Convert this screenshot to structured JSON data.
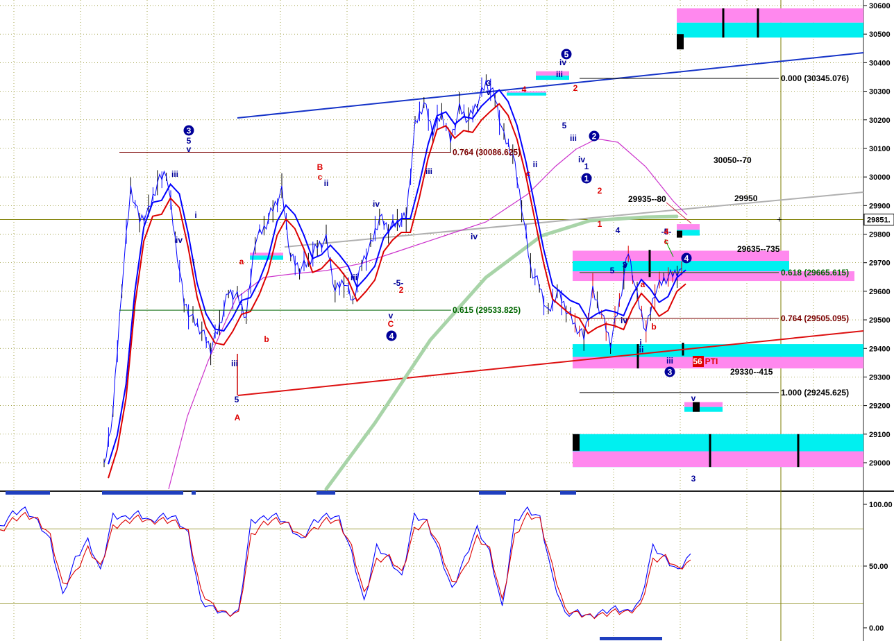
{
  "chart_data": [
    {
      "type": "line",
      "panel": "price",
      "y_axis": {
        "ticks": [
          "30600",
          "30500",
          "30400",
          "30300",
          "30200",
          "30100",
          "30000",
          "29900",
          "29800",
          "29700",
          "29600",
          "29500",
          "29400",
          "29300",
          "29200",
          "29100",
          "29000"
        ],
        "ylim": [
          28920,
          30640
        ],
        "current_price_label": "29851.",
        "grid": true
      },
      "fib_levels": [
        {
          "label": "0.000 (30345.076)",
          "value": 30345.076
        },
        {
          "label": "0.764 (30086.625)",
          "value": 30086.625
        },
        {
          "label": "0.618 (29665.615)",
          "value": 29665.615
        },
        {
          "label": "0.615 (29533.825)",
          "value": 29533.825
        },
        {
          "label": "0.764 (29505.095)",
          "value": 29505.095
        },
        {
          "label": "1.000 (29245.625)",
          "value": 29245.625
        }
      ],
      "zone_labels": [
        "30050--70",
        "29935--80",
        "29950",
        "29635--735",
        "29330--415"
      ],
      "wave_labels": {
        "circled": [
          "3",
          "5",
          "2",
          "1",
          "4",
          "4",
          "3"
        ],
        "blue": [
          "5",
          "v",
          "iii",
          "iv",
          "i",
          "iii",
          "i",
          "ii",
          "iii",
          "iv",
          "iii",
          "v",
          "iv",
          "3",
          "v",
          "ii",
          "iii",
          "iv",
          "5",
          "iii",
          "iv",
          "1",
          "3",
          "5",
          "4",
          "iv",
          "i",
          "ii",
          "iii",
          "v",
          "3",
          "5",
          "-5-",
          "-5-",
          "v"
        ],
        "red": [
          "A",
          "a",
          "b",
          "B",
          "c",
          "C",
          "2",
          "c",
          "a",
          "b",
          "c",
          "1",
          "2",
          "4",
          "2",
          "4",
          "56",
          "PTI"
        ]
      },
      "price_series": {
        "name": "",
        "x": [
          0,
          4,
          8,
          12,
          16,
          20,
          24,
          28,
          32,
          36,
          40,
          44,
          48,
          52,
          56,
          60,
          64,
          68,
          72,
          76,
          80,
          84,
          88,
          92,
          96,
          100,
          104,
          108,
          112,
          116,
          120,
          124,
          128,
          132,
          136,
          140,
          144,
          148,
          152,
          156,
          160,
          164,
          168,
          172,
          176,
          180,
          184,
          188,
          192,
          196,
          200,
          204,
          208,
          212,
          216,
          220,
          224,
          228,
          232,
          236,
          240,
          244,
          248,
          252,
          256,
          260
        ],
        "values": [
          28980,
          29180,
          29620,
          29960,
          29850,
          29880,
          29980,
          30020,
          29780,
          29560,
          29500,
          29460,
          29400,
          29480,
          29600,
          29580,
          29510,
          29780,
          29820,
          29890,
          29950,
          29720,
          29680,
          29700,
          29760,
          29780,
          29600,
          29640,
          29560,
          29700,
          29760,
          29860,
          29820,
          29840,
          29860,
          30180,
          30260,
          30160,
          30220,
          30130,
          30240,
          30200,
          30260,
          30330,
          30280,
          30140,
          30080,
          29900,
          29680,
          29620,
          29520,
          29600,
          29540,
          29480,
          29440,
          29600,
          29520,
          29420,
          29560,
          29740,
          29580,
          29460,
          29600,
          29640,
          29660,
          29680
        ]
      }
    },
    {
      "type": "line",
      "panel": "oscillator",
      "y_axis": {
        "ticks": [
          "100.00",
          "50.00",
          "0.00"
        ],
        "ylim": [
          0,
          100
        ]
      },
      "series": [
        {
          "name": "",
          "color": "#0000ff",
          "values": [
            80,
            92,
            95,
            85,
            70,
            25,
            55,
            70,
            45,
            90,
            88,
            92,
            85,
            90,
            88,
            75,
            20,
            15,
            10,
            12,
            85,
            88,
            90,
            82,
            70,
            85,
            90,
            88,
            60,
            20,
            65,
            55,
            40,
            90,
            85,
            60,
            30,
            55,
            80,
            60,
            15,
            85,
            95,
            88,
            40,
            10,
            12,
            8,
            12,
            15,
            12,
            20,
            65,
            55,
            45,
            60
          ]
        },
        {
          "name": "",
          "color": "#dd0000",
          "values": [
            78,
            88,
            92,
            88,
            75,
            35,
            45,
            65,
            50,
            82,
            86,
            90,
            86,
            88,
            86,
            78,
            30,
            18,
            12,
            12,
            75,
            85,
            88,
            84,
            74,
            80,
            88,
            86,
            66,
            28,
            55,
            58,
            45,
            80,
            86,
            66,
            36,
            48,
            74,
            64,
            22,
            75,
            92,
            88,
            50,
            15,
            12,
            10,
            11,
            14,
            13,
            18,
            55,
            58,
            48,
            55
          ]
        }
      ]
    }
  ],
  "colors": {
    "price": "#0000ff",
    "fast_ma": "#dd0000",
    "upper_band": "#0000ff",
    "slow_ma": "#cc33cc",
    "long_ma": "#a8d4a8",
    "cyan_zone": "#00f0f0",
    "pink_zone": "#ff88ee",
    "grid": "#7e7e00",
    "fib_black": "#000000",
    "fib_darkred": "#7a0000",
    "fib_green": "#006600",
    "label_red": "#dd0000",
    "label_blue": "#000099"
  }
}
